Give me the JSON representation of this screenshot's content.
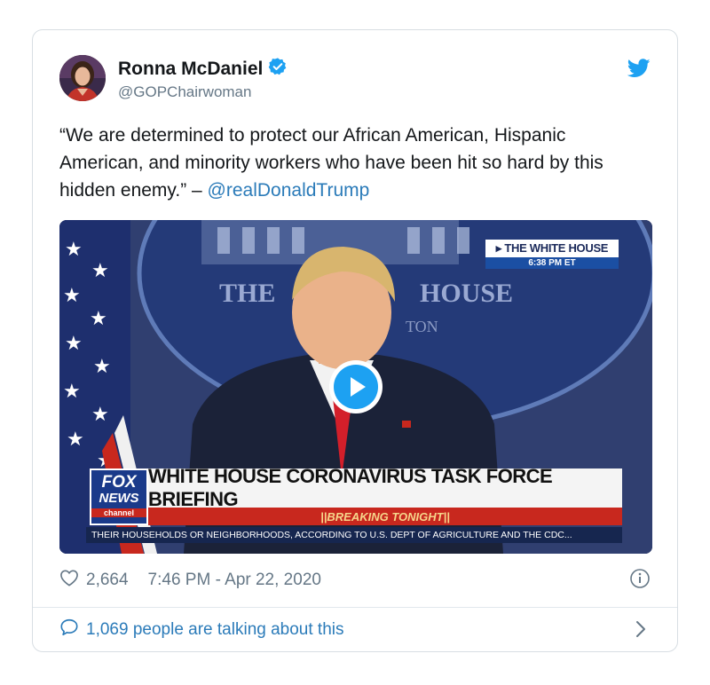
{
  "author": {
    "name": "Ronna McDaniel",
    "handle": "@GOPChairwoman",
    "verified": true
  },
  "tweet": {
    "text": "“We are determined to protect our African American, Hispanic American, and minority workers who have been hit so hard by this hidden enemy.” – ",
    "mention": "@realDonaldTrump"
  },
  "media": {
    "type": "video",
    "location_badge": "THE WHITE HOUSE",
    "location_time": "6:38 PM ET",
    "backdrop_left": "THE",
    "backdrop_right": "HOUSE",
    "backdrop_sub": "TON",
    "network_logo_1": "FOX",
    "network_logo_2": "NEWS",
    "network_logo_3": "channel",
    "headline": "WHITE HOUSE CORONAVIRUS TASK FORCE BRIEFING",
    "breaking": "BREAKING TONIGHT",
    "ticker": "THEIR HOUSEHOLDS OR NEIGHBORHOODS, ACCORDING TO U.S. DEPT OF AGRICULTURE AND THE CDC..."
  },
  "meta": {
    "likes": "2,664",
    "timestamp": "7:46 PM - Apr 22, 2020"
  },
  "footer": {
    "talking": "1,069 people are talking about this"
  },
  "colors": {
    "link": "#2b7bb9",
    "twitter_blue": "#1da1f2",
    "muted": "#657786"
  },
  "icons": [
    "verified-badge-icon",
    "twitter-bird-icon",
    "play-icon",
    "heart-icon",
    "info-icon",
    "comment-bubble-icon",
    "chevron-right-icon"
  ]
}
